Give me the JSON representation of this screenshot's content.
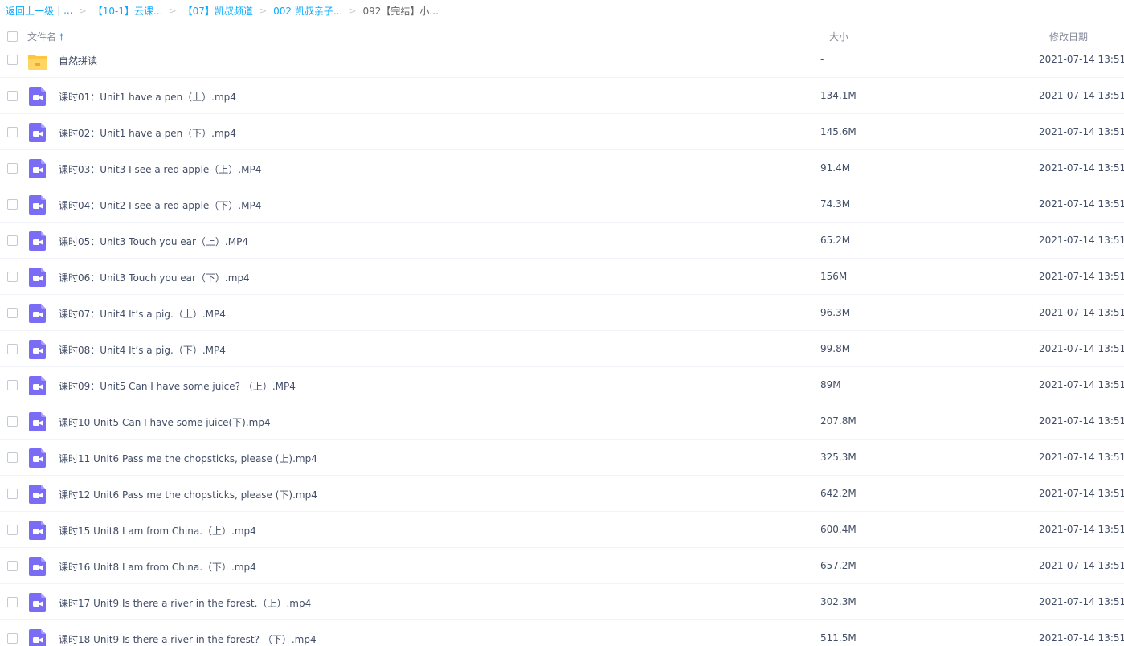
{
  "breadcrumb": {
    "back": "返回上一级",
    "ellipsis": "...",
    "items": [
      "【10-1】云课...",
      "【07】凯叔频道",
      "002 凯叔亲子..."
    ],
    "current": "092【完结】小..."
  },
  "header": {
    "name": "文件名",
    "size": "大小",
    "date": "修改日期"
  },
  "colors": {
    "accent": "#09aaff",
    "folder": "#ffc53d",
    "video": "#7b6cf6"
  },
  "files": [
    {
      "icon": "folder-icon",
      "name": "自然拼读",
      "size": "-",
      "date": "2021-07-14 13:51"
    },
    {
      "icon": "video-icon",
      "name": "课时01：Unit1 have a pen（上）.mp4",
      "size": "134.1M",
      "date": "2021-07-14 13:51"
    },
    {
      "icon": "video-icon",
      "name": "课时02：Unit1 have a pen（下）.mp4",
      "size": "145.6M",
      "date": "2021-07-14 13:51"
    },
    {
      "icon": "video-icon",
      "name": "课时03：Unit3 I see a red apple（上）.MP4",
      "size": "91.4M",
      "date": "2021-07-14 13:51"
    },
    {
      "icon": "video-icon",
      "name": "课时04：Unit2 I see a red apple（下）.MP4",
      "size": "74.3M",
      "date": "2021-07-14 13:51"
    },
    {
      "icon": "video-icon",
      "name": "课时05：Unit3 Touch you ear（上）.MP4",
      "size": "65.2M",
      "date": "2021-07-14 13:51"
    },
    {
      "icon": "video-icon",
      "name": "课时06：Unit3 Touch you ear（下）.mp4",
      "size": "156M",
      "date": "2021-07-14 13:51"
    },
    {
      "icon": "video-icon",
      "name": "课时07：Unit4 It’s a pig.（上）.MP4",
      "size": "96.3M",
      "date": "2021-07-14 13:51"
    },
    {
      "icon": "video-icon",
      "name": "课时08：Unit4 It’s a pig.（下）.MP4",
      "size": "99.8M",
      "date": "2021-07-14 13:51"
    },
    {
      "icon": "video-icon",
      "name": "课时09：Unit5 Can I have some juice? （上）.MP4",
      "size": "89M",
      "date": "2021-07-14 13:51"
    },
    {
      "icon": "video-icon",
      "name": "课时10 Unit5 Can I have some juice(下).mp4",
      "size": "207.8M",
      "date": "2021-07-14 13:51"
    },
    {
      "icon": "video-icon",
      "name": "课时11 Unit6 Pass me the chopsticks, please (上).mp4",
      "size": "325.3M",
      "date": "2021-07-14 13:51"
    },
    {
      "icon": "video-icon",
      "name": "课时12 Unit6 Pass me the chopsticks, please (下).mp4",
      "size": "642.2M",
      "date": "2021-07-14 13:51"
    },
    {
      "icon": "video-icon",
      "name": "课时15 Unit8 I am from China.（上）.mp4",
      "size": "600.4M",
      "date": "2021-07-14 13:51"
    },
    {
      "icon": "video-icon",
      "name": "课时16 Unit8 I am from China.（下）.mp4",
      "size": "657.2M",
      "date": "2021-07-14 13:51"
    },
    {
      "icon": "video-icon",
      "name": "课时17 Unit9 Is there a river in the forest.（上）.mp4",
      "size": "302.3M",
      "date": "2021-07-14 13:51"
    },
    {
      "icon": "video-icon",
      "name": "课时18 Unit9 Is there a river in the forest? （下）.mp4",
      "size": "511.5M",
      "date": "2021-07-14 13:51"
    }
  ]
}
